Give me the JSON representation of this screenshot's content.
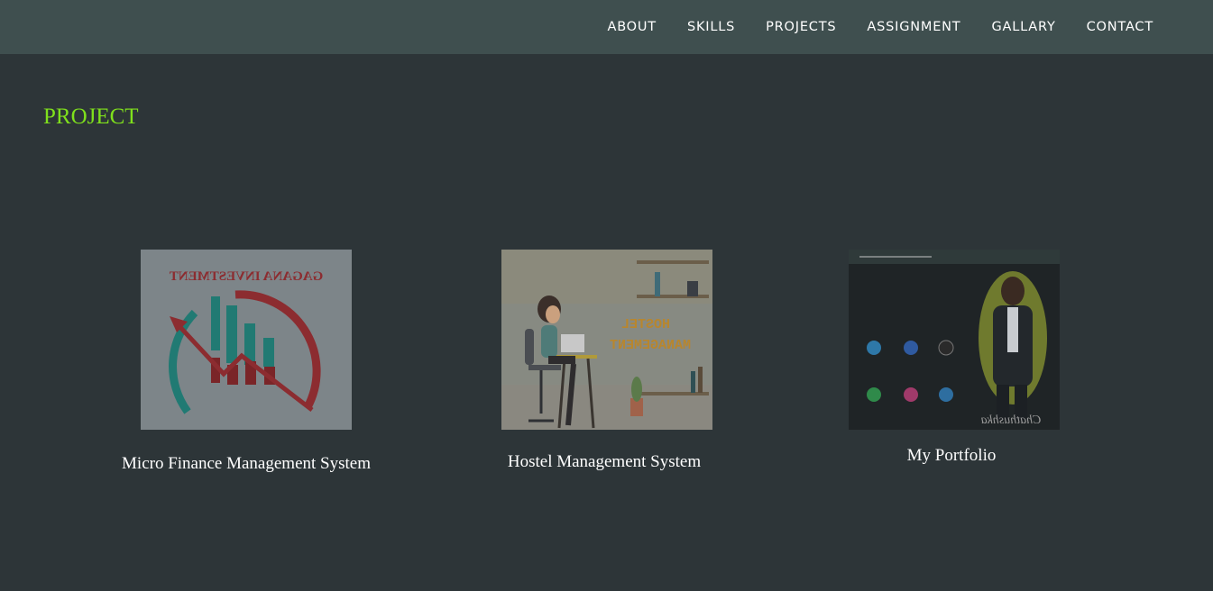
{
  "nav": {
    "items": [
      {
        "label": "ABOUT"
      },
      {
        "label": "SKILLS"
      },
      {
        "label": "PROJECTS"
      },
      {
        "label": "ASSIGNMENT"
      },
      {
        "label": "GALLARY"
      },
      {
        "label": "CONTACT"
      }
    ]
  },
  "section": {
    "title": "PROJECT"
  },
  "projects": [
    {
      "title": "Micro Finance Management System",
      "image_text": "GAGANA INVESTMENT",
      "icon": "finance-chart-logo"
    },
    {
      "title": "Hostel Management System",
      "image_text_line1": "HOSTEL",
      "image_text_line2": "MANAGEMENT",
      "icon": "person-at-laptop-illustration"
    },
    {
      "title": "My Portfolio",
      "image_signature": "Chathushka",
      "icon": "portfolio-screenshot"
    }
  ],
  "colors": {
    "background": "#2d3538",
    "navbar": "#3f4f4f",
    "accent": "#7fe01c",
    "text": "#ffffff"
  }
}
